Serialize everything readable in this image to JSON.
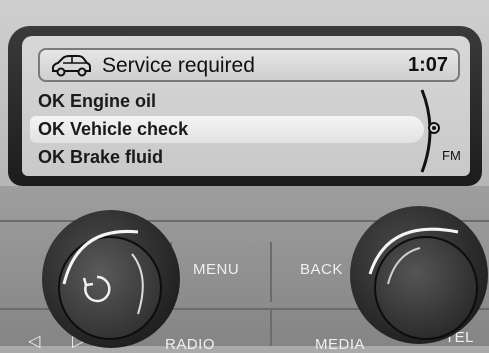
{
  "display": {
    "title": "Service required",
    "clock": "1:07",
    "items": [
      {
        "label": "OK Engine oil"
      },
      {
        "label": "OK Vehicle check",
        "selected": true
      },
      {
        "label": "OK Brake fluid"
      }
    ],
    "band": "FM",
    "car_icon": "car-icon"
  },
  "buttons": {
    "menu": "MENU",
    "back": "BACK",
    "radio": "RADIO",
    "media": "MEDIA",
    "tel": "TEL"
  },
  "icons": {
    "power": "power-icon",
    "prev": "prev-icon",
    "next": "next-icon"
  }
}
